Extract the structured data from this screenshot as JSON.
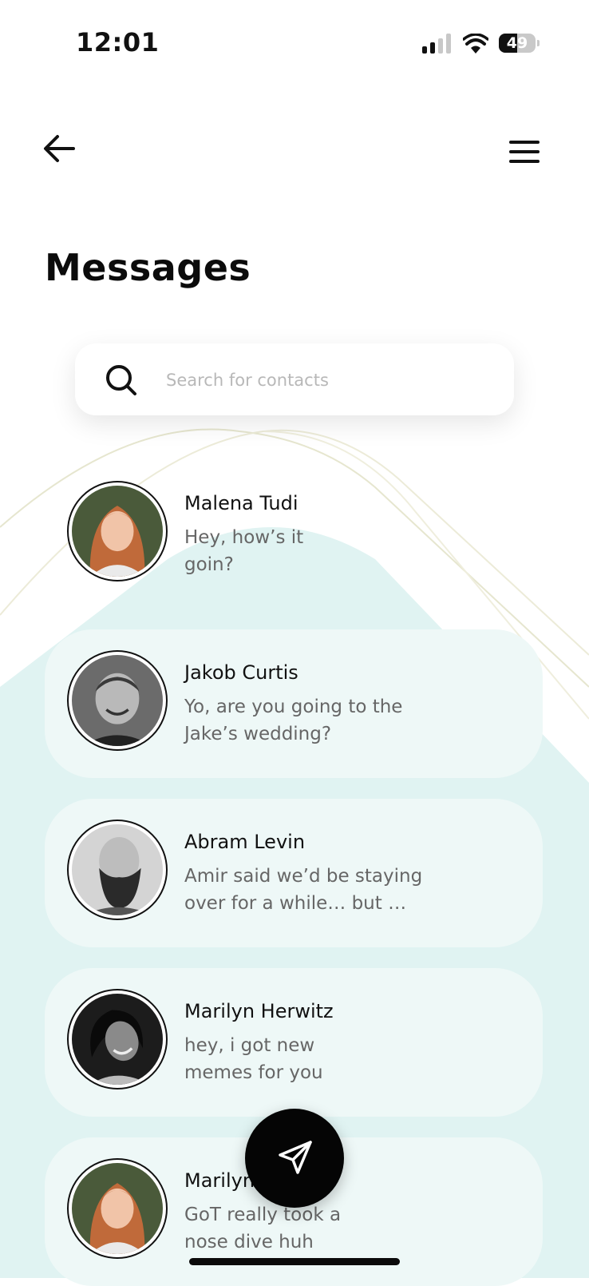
{
  "status_bar": {
    "time": "12:01",
    "battery": "49",
    "battery_level": 0.49
  },
  "header": {
    "title": "Messages"
  },
  "search": {
    "placeholder": "Search for contacts",
    "value": ""
  },
  "conversations": [
    {
      "name": "Malena Tudi",
      "message": "Hey, how’s it goin?",
      "avatar": "woman-red-hair-photo"
    },
    {
      "name": "Jakob Curtis",
      "message": "Yo, are you going to the Jake’s wedding?",
      "avatar": "man-smiling-photo"
    },
    {
      "name": "Abram Levin",
      "message": "Amir said we’d be staying over for a while… but …",
      "avatar": "bearded-man-photo"
    },
    {
      "name": "Marilyn Herwitz",
      "message": "hey, i got new memes for you",
      "avatar": "woman-laughing-photo"
    },
    {
      "name": "Marilyn Herwitz",
      "message": "GoT really took a nose dive huh",
      "avatar": "woman-red-hair-photo"
    }
  ],
  "icons": {
    "back": "arrow-left-icon",
    "menu": "hamburger-menu-icon",
    "search": "search-icon",
    "compose": "send-icon"
  },
  "colors": {
    "accent_bg": "#dff3f2",
    "card_bg": "#eef8f7",
    "fab": "#050505",
    "text_primary": "#111111",
    "text_secondary": "#666666"
  }
}
